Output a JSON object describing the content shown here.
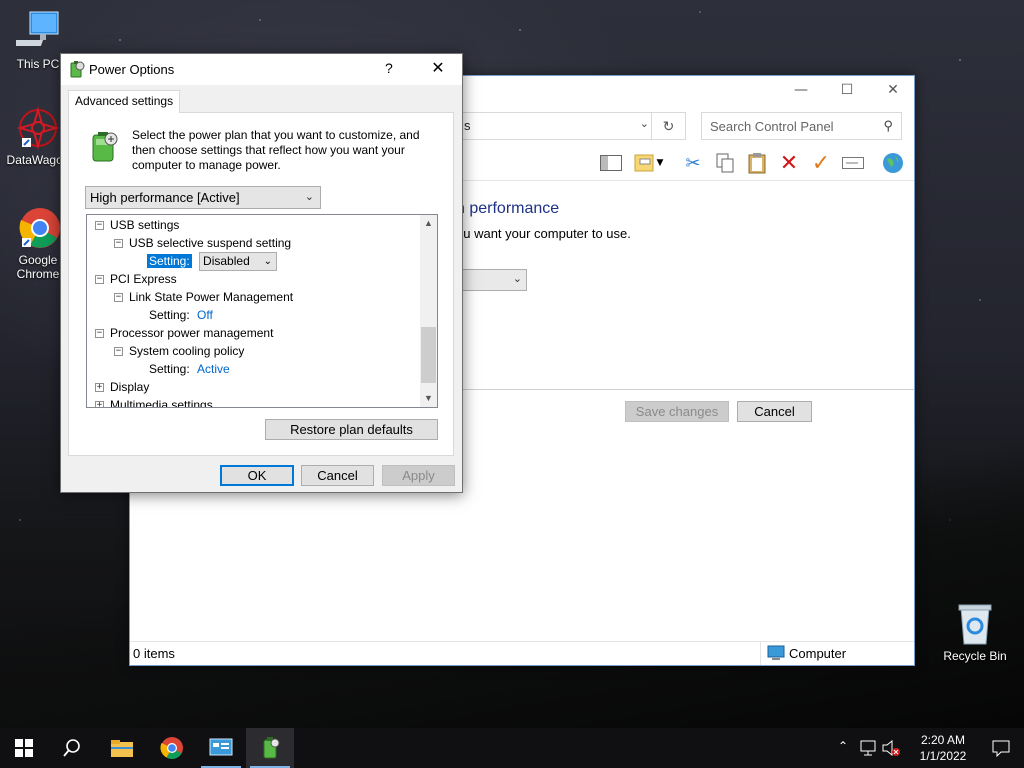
{
  "desktop": {
    "icons": [
      {
        "label": "This PC"
      },
      {
        "label": "DataWagon"
      },
      {
        "label": "Google Chrome"
      },
      {
        "label": "Recycle Bin"
      }
    ]
  },
  "control_panel": {
    "address_fragment": "s",
    "search_placeholder": "Search Control Panel",
    "heading_fragment": "n performance",
    "subtext_fragment": "ou want your computer to use.",
    "save_changes": "Save changes",
    "cancel": "Cancel",
    "status_items": "0 items",
    "status_location": "Computer",
    "window_controls": {
      "minimize": "—",
      "maximize": "☐",
      "close": "✕"
    }
  },
  "power_options": {
    "title": "Power Options",
    "help": "?",
    "close": "✕",
    "tab": "Advanced settings",
    "description": "Select the power plan that you want to customize, and then choose settings that reflect how you want your computer to manage power.",
    "plan_selected": "High performance [Active]",
    "tree": {
      "usb_settings": "USB settings",
      "usb_selective": "USB selective suspend setting",
      "setting_label": "Setting:",
      "usb_value": "Disabled",
      "pci_express": "PCI Express",
      "link_state": "Link State Power Management",
      "pci_value": "Off",
      "processor": "Processor power management",
      "cooling": "System cooling policy",
      "cooling_value": "Active",
      "display": "Display",
      "multimedia": "Multimedia settings"
    },
    "restore_defaults": "Restore plan defaults",
    "ok": "OK",
    "cancel": "Cancel",
    "apply": "Apply"
  },
  "taskbar": {
    "time": "2:20 AM",
    "date": "1/1/2022",
    "icons": [
      "windows-start-icon",
      "search-icon",
      "file-explorer-icon",
      "chrome-icon",
      "control-panel-icon",
      "power-options-icon"
    ]
  },
  "colors": {
    "accent": "#0078d7",
    "link_value": "#0066cc",
    "heading": "#1e3287"
  }
}
